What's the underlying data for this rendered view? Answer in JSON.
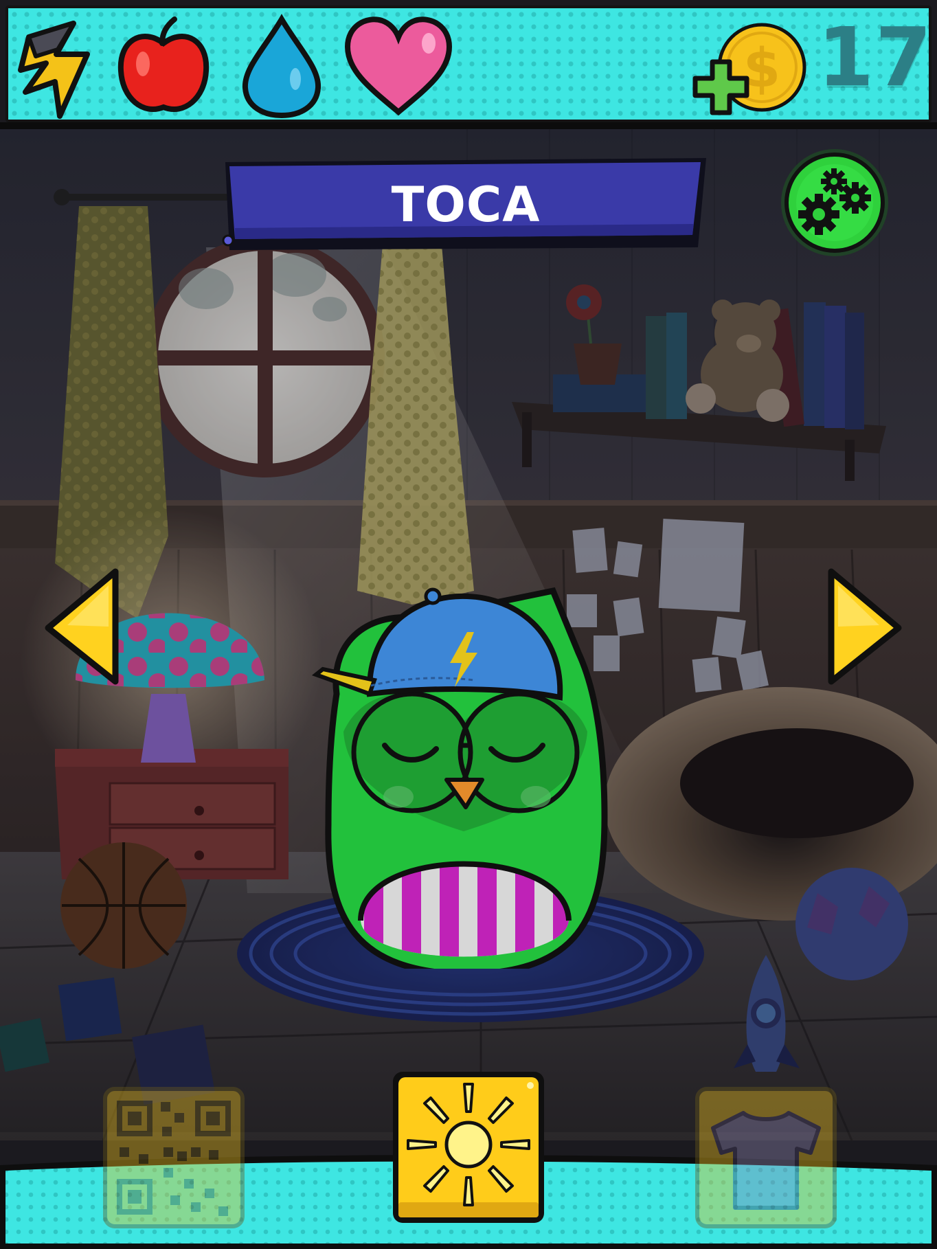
{
  "hud": {
    "coin_count": "17",
    "stats": [
      {
        "icon": "energy-lightning-icon"
      },
      {
        "icon": "hunger-apple-icon"
      },
      {
        "icon": "thirst-water-drop-icon"
      },
      {
        "icon": "love-heart-icon"
      }
    ],
    "add_coins_icon": "add-coins-icon"
  },
  "pet": {
    "name": "TOCA",
    "state": "sleeping"
  },
  "nav": {
    "prev_icon": "arrow-left-icon",
    "next_icon": "arrow-right-icon"
  },
  "actions": {
    "left_icon": "qr-code-icon",
    "center_icon": "sun-light-icon",
    "right_icon": "tshirt-wardrobe-icon"
  },
  "colors": {
    "hud_teal": "#3ee6e2",
    "banner_blue": "#3a3aa8",
    "settings_green": "#2fd13c",
    "arrow_yellow": "#ffd21f",
    "owl_green": "#22c13c",
    "cap_blue": "#3d86d6",
    "light_button_yellow": "#ffcc1a"
  }
}
